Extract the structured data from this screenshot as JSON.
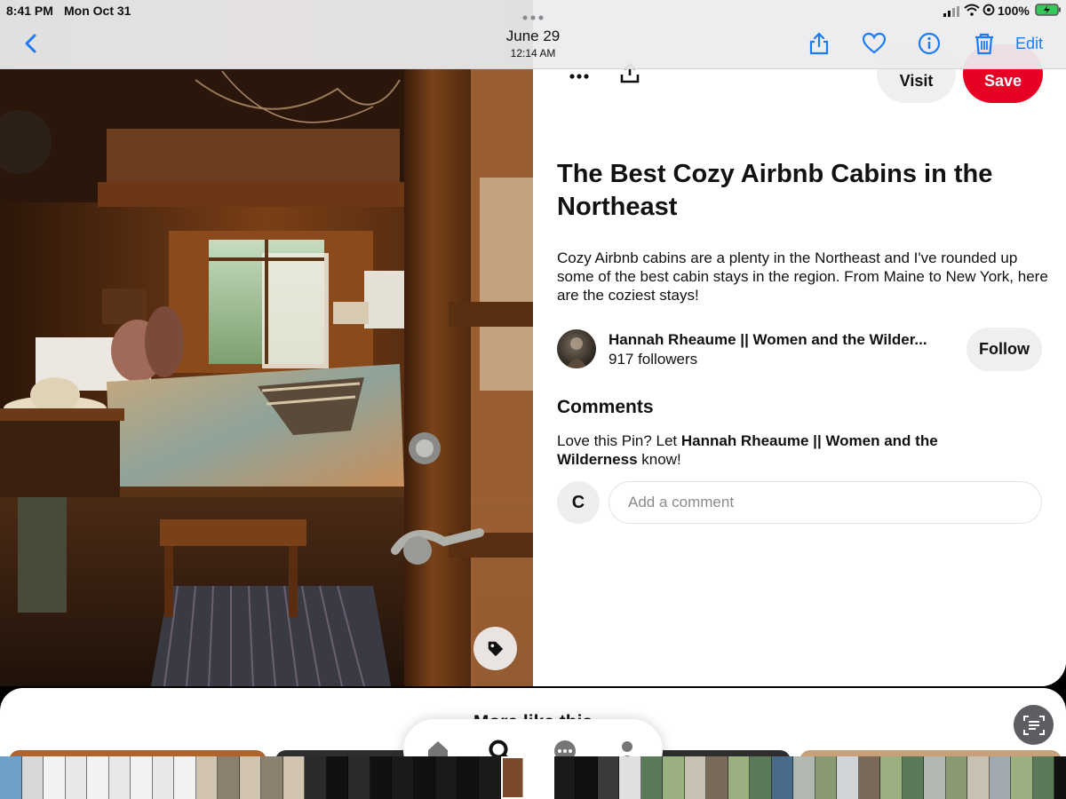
{
  "status_bar": {
    "time": "8:41 PM",
    "date": "Mon Oct 31",
    "battery": "100%"
  },
  "photos_bar": {
    "date": "June 29",
    "time": "12:14 AM",
    "edit_label": "Edit",
    "icons": [
      "back-chevron-icon",
      "share-icon",
      "heart-icon",
      "info-icon",
      "trash-icon"
    ]
  },
  "pin": {
    "visit_label": "Visit",
    "save_label": "Save",
    "title": "The Best Cozy Airbnb Cabins in the Northeast",
    "description": "Cozy Airbnb cabins are a plenty in the Northeast and I've rounded up some of the best cabin stays in the region. From Maine to New York, here are the coziest stays!",
    "author": {
      "name": "Hannah Rheaume || Women and the Wilder...",
      "followers": "917 followers",
      "follow_label": "Follow"
    },
    "comments": {
      "heading": "Comments",
      "prompt_prefix": "Love this Pin? Let ",
      "prompt_name": "Hannah Rheaume || Women and the Wilderness",
      "prompt_suffix": " know!",
      "user_initial": "C",
      "placeholder": "Add a comment"
    }
  },
  "more": {
    "title": "More like this"
  },
  "colors": {
    "accent_blue": "#1a7cf4",
    "pinterest_red": "#e60023",
    "bar_bg": "#ececee"
  }
}
